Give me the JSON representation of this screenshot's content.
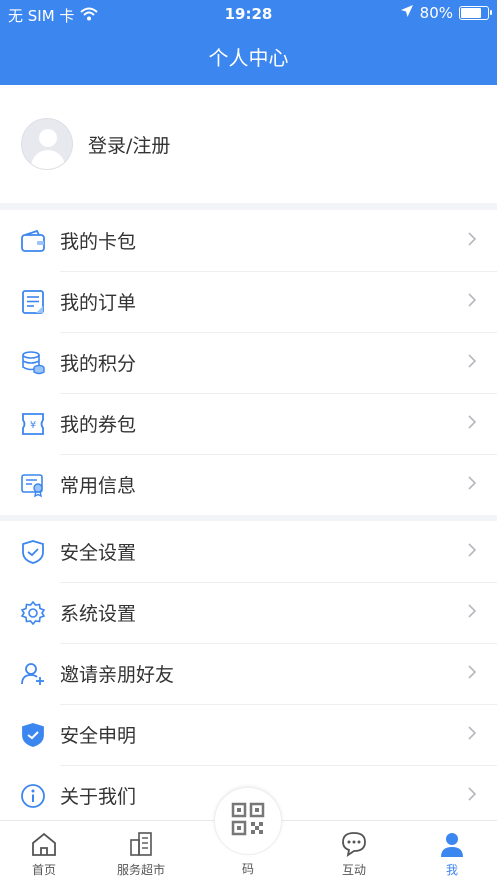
{
  "status_bar": {
    "carrier": "无 SIM 卡",
    "time": "19:28",
    "battery": "80%",
    "battery_level": 0.8
  },
  "header": {
    "title": "个人中心"
  },
  "profile": {
    "login_label": "登录/注册"
  },
  "menu_group_1": [
    {
      "label": "我的卡包",
      "icon": "wallet-icon"
    },
    {
      "label": "我的订单",
      "icon": "order-list-icon"
    },
    {
      "label": "我的积分",
      "icon": "coins-stack-icon"
    },
    {
      "label": "我的券包",
      "icon": "coupon-icon"
    },
    {
      "label": "常用信息",
      "icon": "certificate-icon"
    }
  ],
  "menu_group_2": [
    {
      "label": "安全设置",
      "icon": "shield-icon"
    },
    {
      "label": "系统设置",
      "icon": "gear-icon"
    },
    {
      "label": "邀请亲朋好友",
      "icon": "add-user-icon"
    },
    {
      "label": "安全申明",
      "icon": "shield-check-icon"
    },
    {
      "label": "关于我们",
      "icon": "info-icon"
    }
  ],
  "tabbar": {
    "home": "首页",
    "services": "服务超市",
    "code": "码",
    "interact": "互动",
    "me": "我"
  },
  "colors": {
    "primary": "#3c86f0",
    "text": "#333333",
    "background": "#f2f4f7"
  }
}
